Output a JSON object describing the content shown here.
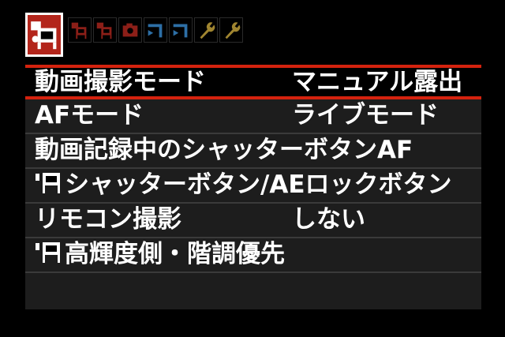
{
  "tabs": [
    {
      "name": "tab-movie-shooting-1",
      "color": "#b3251b",
      "icon": "movie-camera-icon",
      "active": true
    },
    {
      "name": "tab-movie-shooting-2",
      "color": "#8c1f18",
      "icon": "movie-camera-icon",
      "active": false
    },
    {
      "name": "tab-movie-shooting-3",
      "color": "#8c1f18",
      "icon": "movie-camera-icon",
      "active": false
    },
    {
      "name": "tab-movie-shooting-4",
      "color": "#8c1f18",
      "icon": "camera-icon",
      "active": false
    },
    {
      "name": "tab-playback-1",
      "color": "#2d6fa6",
      "icon": "playback-icon",
      "active": false
    },
    {
      "name": "tab-playback-2",
      "color": "#2d6fa6",
      "icon": "playback-icon",
      "active": false
    },
    {
      "name": "tab-setup-1",
      "color": "#a08530",
      "icon": "wrench-icon",
      "active": false
    },
    {
      "name": "tab-setup-2",
      "color": "#a08530",
      "icon": "wrench-icon",
      "active": false
    }
  ],
  "menu": {
    "items": [
      {
        "label": "動画撮影モード",
        "value": "マニュアル露出",
        "selected": true,
        "movie_icon": false
      },
      {
        "label": "AFモード",
        "value": "ライブモード",
        "selected": false,
        "movie_icon": false
      },
      {
        "label": "動画記録中のシャッターボタンAF",
        "value": "",
        "selected": false,
        "movie_icon": false
      },
      {
        "label": "シャッターボタン/AEロックボタン",
        "value": "",
        "selected": false,
        "movie_icon": true
      },
      {
        "label": "リモコン撮影",
        "value": "しない",
        "selected": false,
        "movie_icon": false
      },
      {
        "label": "高輝度側・階調優先",
        "value": "",
        "selected": false,
        "movie_icon": true
      }
    ]
  },
  "colors": {
    "accent": "#d4220e",
    "row_background": "#1d1d1d",
    "divider": "#3a3a3a"
  }
}
